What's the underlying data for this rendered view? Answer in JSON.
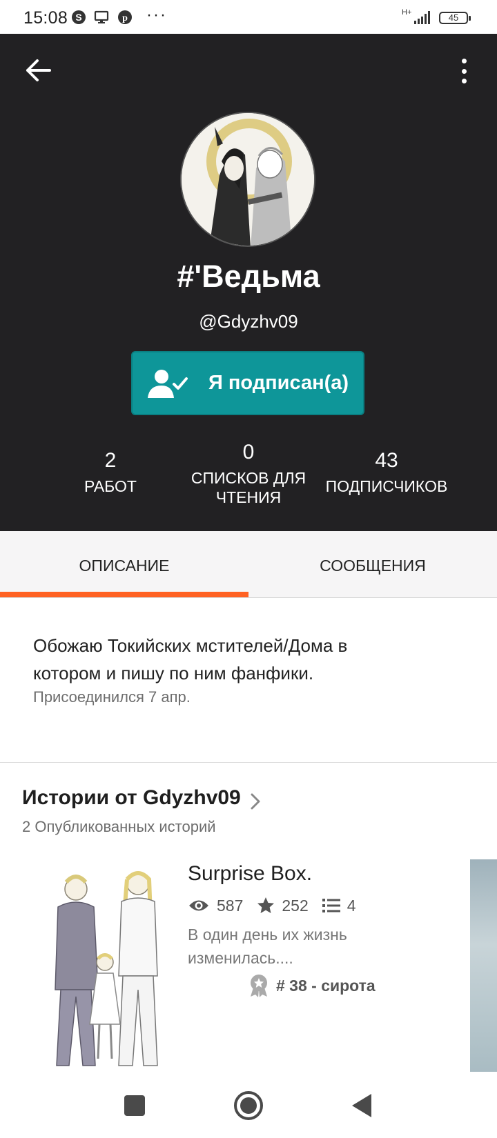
{
  "status_bar": {
    "time": "15:08",
    "network": "H+",
    "battery": "45",
    "more": "···"
  },
  "profile": {
    "display_name": "#'Ведьма",
    "username": "@Gdyzhv09",
    "follow_label": "Я подписан(а)",
    "stats": {
      "works_value": "2",
      "works_label": "РАБОТ",
      "lists_value": "0",
      "lists_label_line1": "СПИСКОВ ДЛЯ",
      "lists_label_line2": "ЧТЕНИЯ",
      "followers_value": "43",
      "followers_label": "ПОДПИСЧИКОВ"
    }
  },
  "tabs": {
    "about": "ОПИСАНИЕ",
    "messages": "СООБЩЕНИЯ",
    "active": "about"
  },
  "about": {
    "text_line1": "Обожаю Токийских мстителей/Дома в",
    "text_line2": "котором и пишу по ним фанфики.",
    "joined": "Присоединился 7 апр."
  },
  "stories": {
    "title": "Истории от Gdyzhv09",
    "count": "2 Опубликованных историй",
    "items": [
      {
        "title": "Surprise Box.",
        "reads": "587",
        "votes": "252",
        "parts": "4",
        "description_line1": "В один день их жизнь",
        "description_line2": "изменилась....",
        "rank": "# 38 - сирота"
      }
    ]
  },
  "colors": {
    "header_bg": "#222123",
    "follow_button": "#0e9699",
    "tab_indicator": "#ff6122"
  },
  "icons": [
    "skype-icon",
    "monitor-icon",
    "pinterest-icon",
    "signal-icon",
    "battery-icon",
    "back-arrow-icon",
    "more-vertical-icon",
    "user-check-icon",
    "chevron-right-icon",
    "eye-icon",
    "star-icon",
    "list-icon",
    "ribbon-icon"
  ]
}
